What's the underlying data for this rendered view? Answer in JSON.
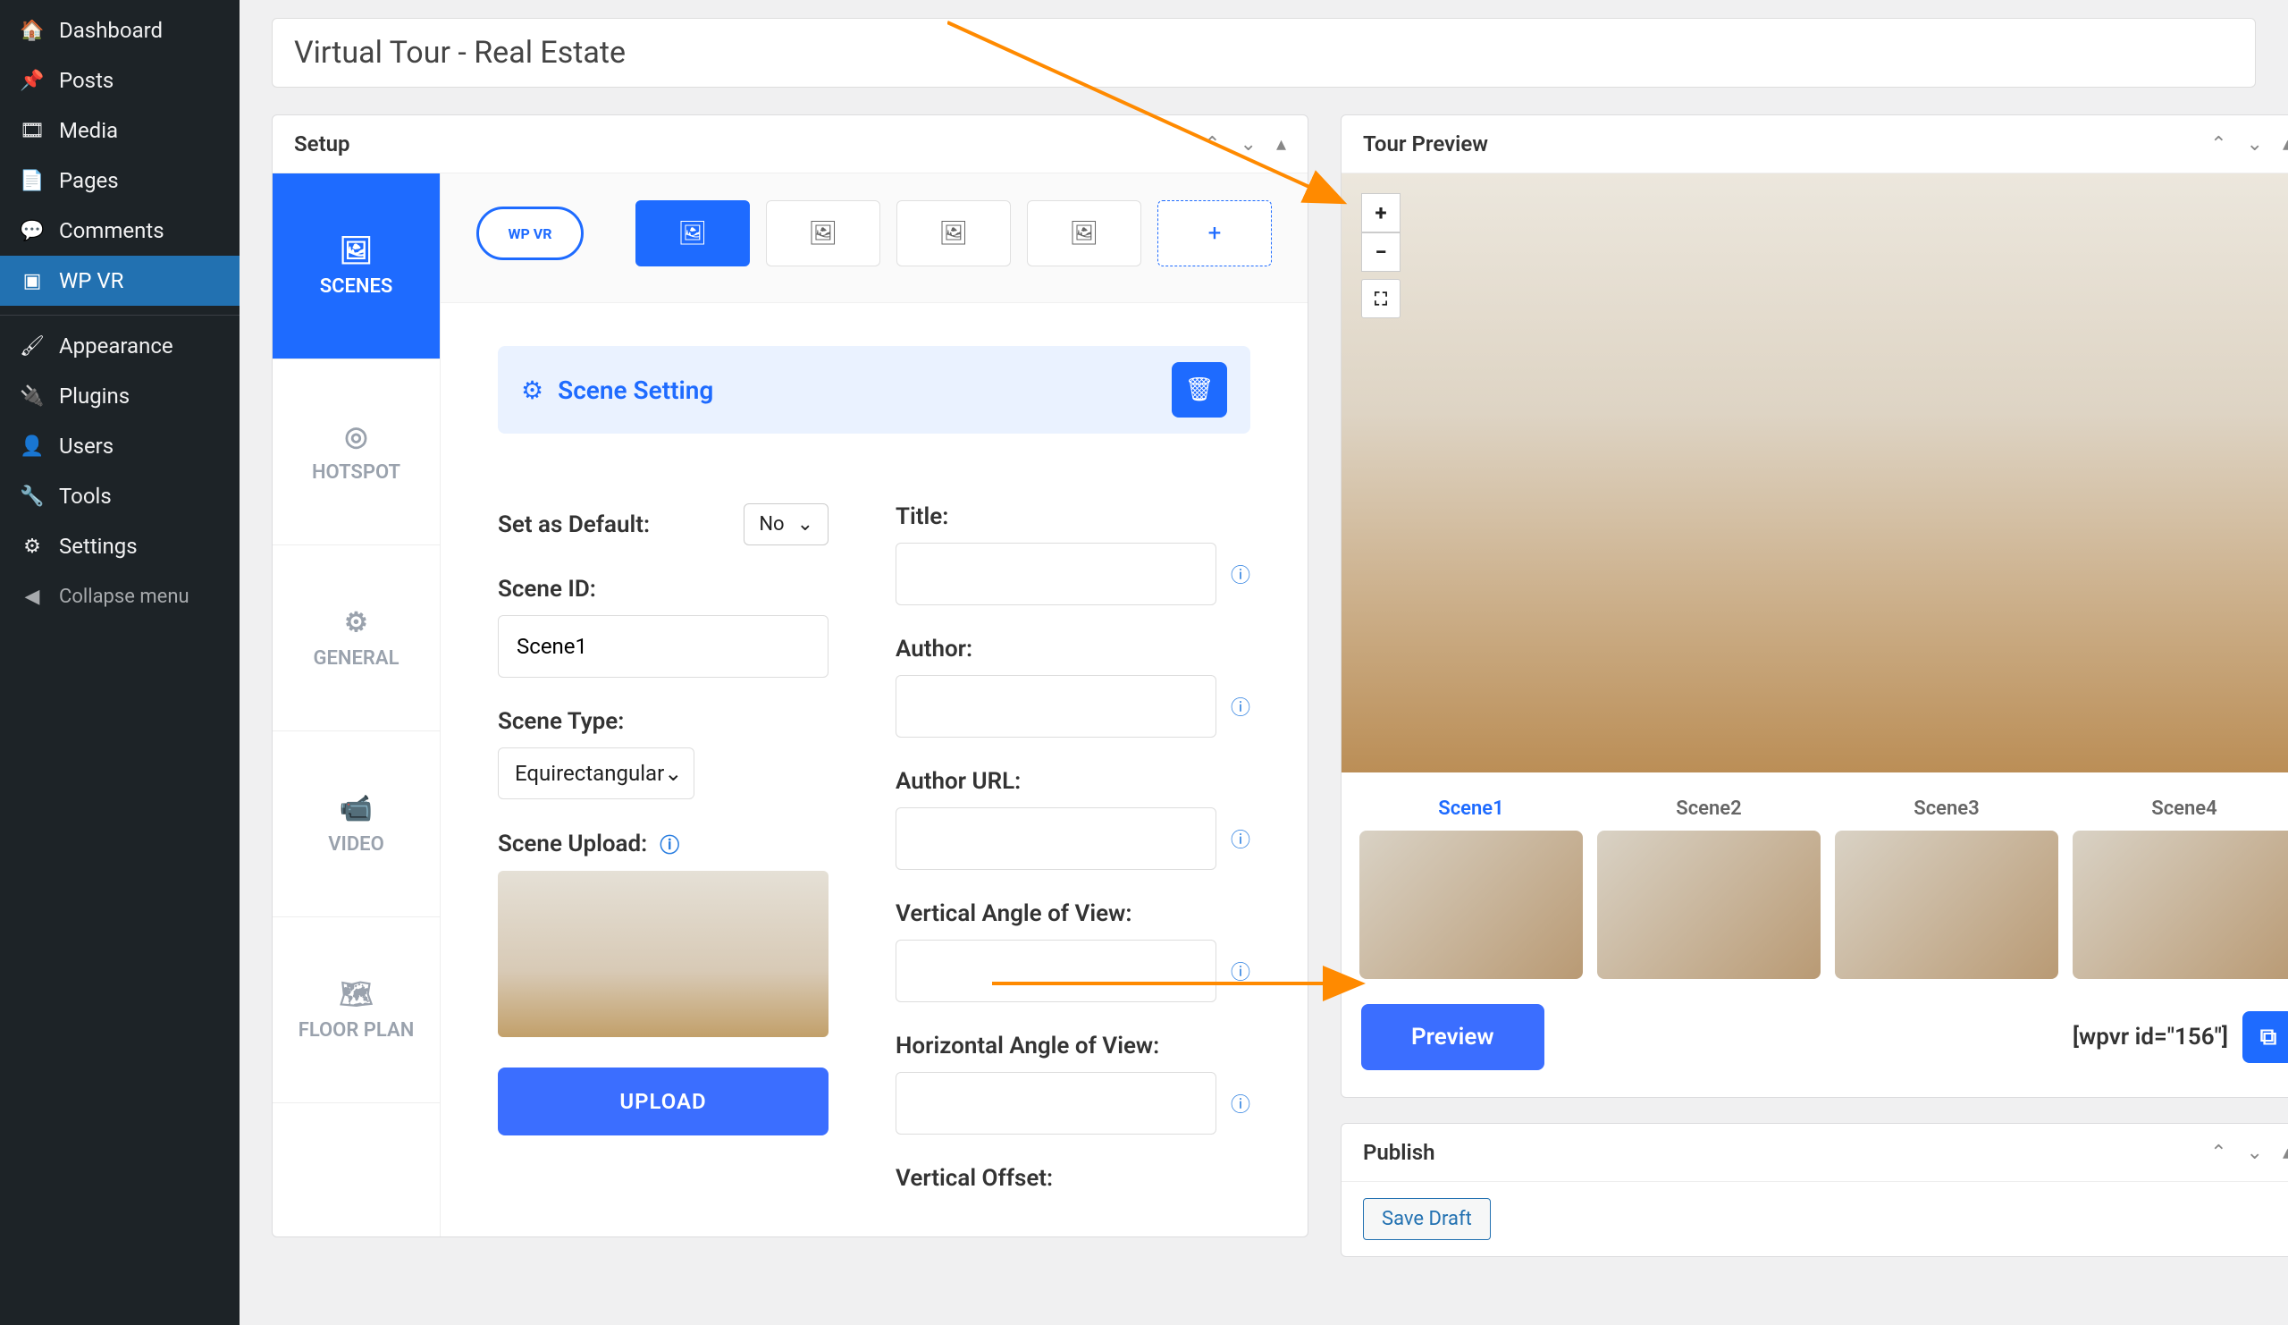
{
  "sidebar": {
    "items": [
      {
        "label": "Dashboard"
      },
      {
        "label": "Posts"
      },
      {
        "label": "Media"
      },
      {
        "label": "Pages"
      },
      {
        "label": "Comments"
      },
      {
        "label": "WP VR"
      },
      {
        "label": "Appearance"
      },
      {
        "label": "Plugins"
      },
      {
        "label": "Users"
      },
      {
        "label": "Tools"
      },
      {
        "label": "Settings"
      },
      {
        "label": "Collapse menu"
      }
    ]
  },
  "page": {
    "title": "Virtual Tour - Real Estate"
  },
  "setup": {
    "panel_title": "Setup",
    "logo": "WP VR",
    "tabs": [
      {
        "label": "SCENES"
      },
      {
        "label": "HOTSPOT"
      },
      {
        "label": "GENERAL"
      },
      {
        "label": "VIDEO"
      },
      {
        "label": "FLOOR PLAN"
      }
    ],
    "plus": "+"
  },
  "scene": {
    "section_title": "Scene Setting",
    "set_default_label": "Set as Default:",
    "set_default_value": "No",
    "scene_id_label": "Scene ID:",
    "scene_id_value": "Scene1",
    "scene_type_label": "Scene Type:",
    "scene_type_value": "Equirectangular",
    "scene_upload_label": "Scene Upload:",
    "upload_btn": "UPLOAD",
    "title_label": "Title:",
    "author_label": "Author:",
    "author_url_label": "Author URL:",
    "va_label": "Vertical Angle of View:",
    "ha_label": "Horizontal Angle of View:",
    "vo_label": "Vertical Offset:"
  },
  "preview": {
    "panel_title": "Tour Preview",
    "zoom_in": "+",
    "zoom_out": "−",
    "scenes": [
      "Scene1",
      "Scene2",
      "Scene3",
      "Scene4"
    ],
    "preview_btn": "Preview",
    "shortcode": "[wpvr id=\"156\"]"
  },
  "publish": {
    "panel_title": "Publish",
    "save_draft": "Save Draft"
  }
}
